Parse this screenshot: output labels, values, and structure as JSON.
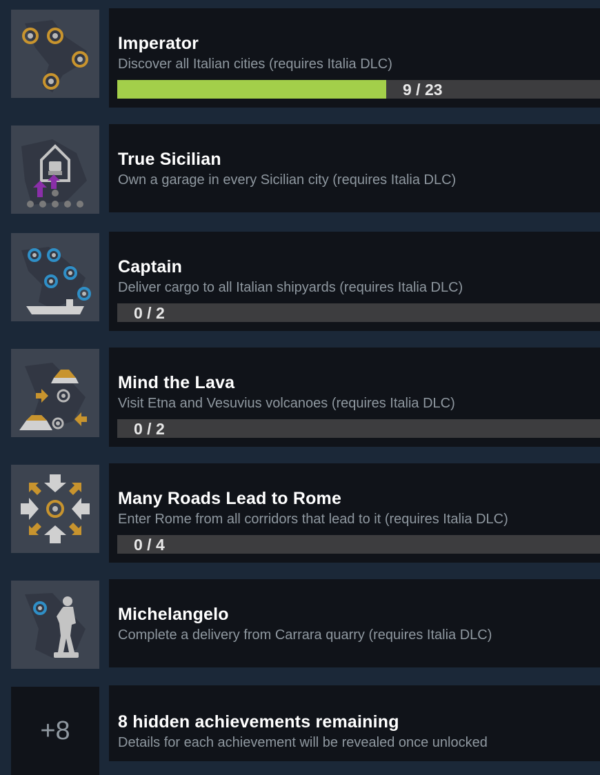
{
  "achievements": [
    {
      "title": "Imperator",
      "description": "Discover all Italian cities (requires Italia DLC)",
      "progress_text": "9 / 23",
      "progress": 0.39,
      "icon": "italy-cities-icon"
    },
    {
      "title": "True Sicilian",
      "description": "Own a garage in every Sicilian city (requires Italia DLC)",
      "icon": "garage-icon"
    },
    {
      "title": "Captain",
      "description": "Deliver cargo to all Italian shipyards (requires Italia DLC)",
      "progress_text": "0 / 2",
      "progress": 0,
      "icon": "shipyard-icon"
    },
    {
      "title": "Mind the Lava",
      "description": "Visit Etna and Vesuvius volcanoes (requires Italia DLC)",
      "progress_text": "0 / 2",
      "progress": 0,
      "icon": "volcano-icon"
    },
    {
      "title": "Many Roads Lead to Rome",
      "description": "Enter Rome from all corridors that lead to it (requires Italia DLC)",
      "progress_text": "0 / 4",
      "progress": 0,
      "icon": "roads-to-rome-icon"
    },
    {
      "title": "Michelangelo",
      "description": "Complete a delivery from Carrara quarry (requires Italia DLC)",
      "icon": "statue-icon"
    }
  ],
  "hidden": {
    "count_label": "+8",
    "title": "8 hidden achievements remaining",
    "description": "Details for each achievement will be revealed once unlocked"
  },
  "colors": {
    "background": "#1b2838",
    "panel": "#101319",
    "progress_fill": "#a3cf4a",
    "progress_track": "#3d3d3f",
    "icon_gold": "#c8942e",
    "icon_blue": "#2f8fc7",
    "icon_purple": "#8a2fa8"
  }
}
